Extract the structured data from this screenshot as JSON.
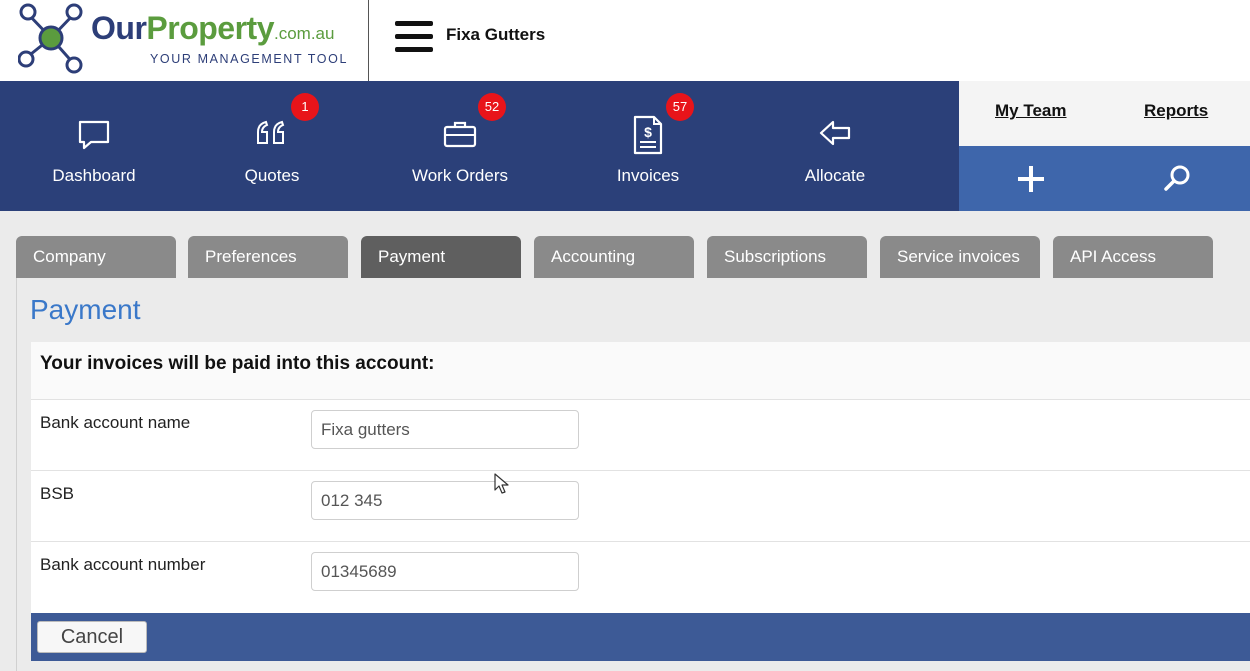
{
  "header": {
    "logo": {
      "our": "Our",
      "property": "Property",
      "domain": ".com.au",
      "tagline": "YOUR MANAGEMENT TOOL"
    },
    "company_name": "Fixa Gutters"
  },
  "nav": {
    "items": [
      {
        "label": "Dashboard",
        "icon": "speech-bubble-icon"
      },
      {
        "label": "Quotes",
        "icon": "quote-marks-icon",
        "badge": "1"
      },
      {
        "label": "Work Orders",
        "icon": "briefcase-icon",
        "badge": "52"
      },
      {
        "label": "Invoices",
        "icon": "invoice-dollar-icon",
        "badge": "57"
      },
      {
        "label": "Allocate",
        "icon": "arrow-left-icon"
      }
    ],
    "my_team": "My Team",
    "reports": "Reports"
  },
  "tabs": [
    {
      "label": "Company"
    },
    {
      "label": "Preferences"
    },
    {
      "label": "Payment",
      "active": true
    },
    {
      "label": "Accounting"
    },
    {
      "label": "Subscriptions"
    },
    {
      "label": "Service invoices"
    },
    {
      "label": "API Access"
    }
  ],
  "content": {
    "title": "Payment",
    "heading": "Your invoices will be paid into this account:",
    "fields": [
      {
        "label": "Bank account name",
        "value": "Fixa gutters"
      },
      {
        "label": "BSB",
        "value": "012 345"
      },
      {
        "label": "Bank account number",
        "value": "01345689"
      }
    ],
    "cancel_label": "Cancel"
  },
  "colors": {
    "nav_bg": "#2b4079",
    "action_bg": "#3e66ab",
    "badge": "#e8141a",
    "title": "#3a78c9",
    "logo_green": "#5b9c3e",
    "logo_navy": "#2d3e78"
  }
}
